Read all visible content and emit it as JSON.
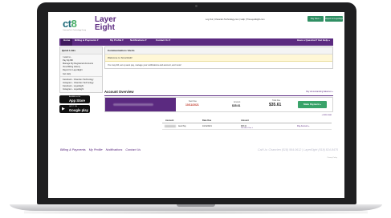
{
  "header": {
    "logo_primary": "ct",
    "logo_primary_digit": "8",
    "logo_sub": "CommonTech Technology Group",
    "logo_secondary_line1": "Layer",
    "logo_secondary_line2": "Eight",
    "top_links": "Log Out  |  Chanclen Technology.com  |  Help  |  TheLayerEight.com",
    "pay_now_button": "Pay Now »",
    "layer_eight_button": "Report for LayerEight »"
  },
  "nav": {
    "items": [
      "Home",
      "Billing & Payments ▾",
      "My Profile ▾",
      "Notifications ▾",
      "Contact Us ▾"
    ],
    "help_label": "Have a Question? Get Help »"
  },
  "sidebar": {
    "title": "Quick Links",
    "group1": [
      "I want to...",
      "Pay My Bill",
      "Manage My Registered Accounts",
      "View Billing History",
      "Report for LayerEight",
      "Get Help"
    ],
    "group2": [
      "Facebook - Chanclen Technology",
      "Instagram - Chanclen Technology",
      "Facebook - LayerEight",
      "Instagram - LayerEight"
    ],
    "app_store": {
      "small": "Available on the",
      "big": "App Store",
      "icon": "apple-icon"
    },
    "google_play": {
      "small": "GET IT ON",
      "big": "Google play",
      "icon": "play-icon"
    }
  },
  "communication": {
    "header": "Communication / Alerts",
    "welcome": "Welcome to SmartHub!",
    "text": "You may bill, set up auto pay, manage your notifications and account, and more!"
  },
  "overview": {
    "title": "Account Overview",
    "top_link": "Pay all outstanding balances »",
    "columns": {
      "due_label": "Next Due",
      "due_value": "10/11/2021",
      "amount_label": "Amount",
      "amount_value": "$35.61",
      "total_label": "Total Due",
      "total_value": "$35.61"
    },
    "pay_button": "Make Payment »",
    "balance_link": "+ Auto Loan",
    "table": {
      "headers": [
        "Account",
        "Date Due",
        "Amount"
      ],
      "rows": [
        {
          "account_suffix": "Auto Pay",
          "date": "10/11/2021",
          "amount": "$35.61",
          "amount_link": "Uncollect Your »",
          "action": "Pay Account »"
        }
      ]
    }
  },
  "footer": {
    "links": [
      "Billing & Payments",
      "My Profile",
      "Notifications",
      "Contact Us"
    ],
    "contact": "Call Us: Chanclen (518) 564-0612  |  LayerEight (518) 824-8475",
    "small": "Privacy Policy"
  },
  "colors": {
    "brand_purple": "#5b2a80",
    "accent_green": "#3aa36a",
    "logo_teal": "#1f6b7a"
  }
}
